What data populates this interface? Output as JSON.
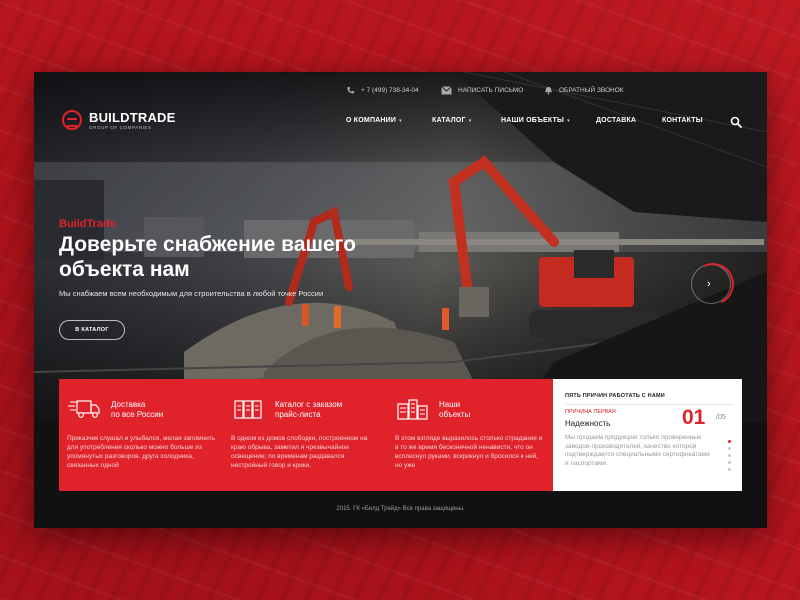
{
  "colors": {
    "brand_red": "#e0222b",
    "backdrop_red": "#b3141c",
    "frame_dark": "#111111"
  },
  "topbar": {
    "phone": "+ 7 (499) 738-34-04",
    "email": "НАПИСАТЬ ПИСЬМО",
    "callback": "ОБРАТНЫЙ ЗВОНОК"
  },
  "logo": {
    "name": "BUILDTRADE",
    "tagline": "GROUP OF COMPANIES"
  },
  "nav": {
    "items": [
      "О КОМПАНИИ",
      "КАТАЛОГ",
      "НАШИ ОБЪЕКТЫ",
      "ДОСТАВКА",
      "КОНТАКТЫ"
    ],
    "dropdown_marker": "▾"
  },
  "hero": {
    "kicker": "BuildTrade",
    "title": "Доверьте снабжение вашего объекта нам",
    "text": "Мы снабжаем всем необходимым для строительства в любой точке России",
    "button": "В КАТАЛОГ",
    "next_arrow": "›"
  },
  "features": [
    {
      "icon": "truck-icon",
      "title_line1": "Доставка",
      "title_line2": "по все России",
      "text": "Приказчик слушал и улыбался, желая запомнить для употребления сколько можно больше из упомянутых разговоров. друга холодника, связанных одной"
    },
    {
      "icon": "catalog-icon",
      "title_line1": "Каталог с заказом",
      "title_line2": "прайс-листа",
      "text": "В одном из домов слободки, построенном на краю обрыва, заметил я чрезвычайное освещение; по временам раздавался нестройный говор и крики,"
    },
    {
      "icon": "buildings-icon",
      "title_line1": "Наши",
      "title_line2": "объекты",
      "text": "В этом взгляде выразилось столько страдания и в то же время бесконечной ненависти, что он всплеснул руками, вскрикнул и бросился к ней, но уже"
    }
  ],
  "reasons": {
    "heading": "ПЯТЬ ПРИЧИН РАБОТАТЬ С НАМИ",
    "kicker": "ПРИЧИНА ПЕРВАЯ",
    "title": "Надежность",
    "number": "01",
    "total": "/05",
    "text": "Мы продаем продукцию только проверенных заводов-производителей, качество которой подтверждается специальными сертификатами и паспортами.",
    "current_index": 1,
    "dot_count": 5
  },
  "footer": {
    "text": "2015. ГК «Билд Трейд» Все права защищены."
  }
}
